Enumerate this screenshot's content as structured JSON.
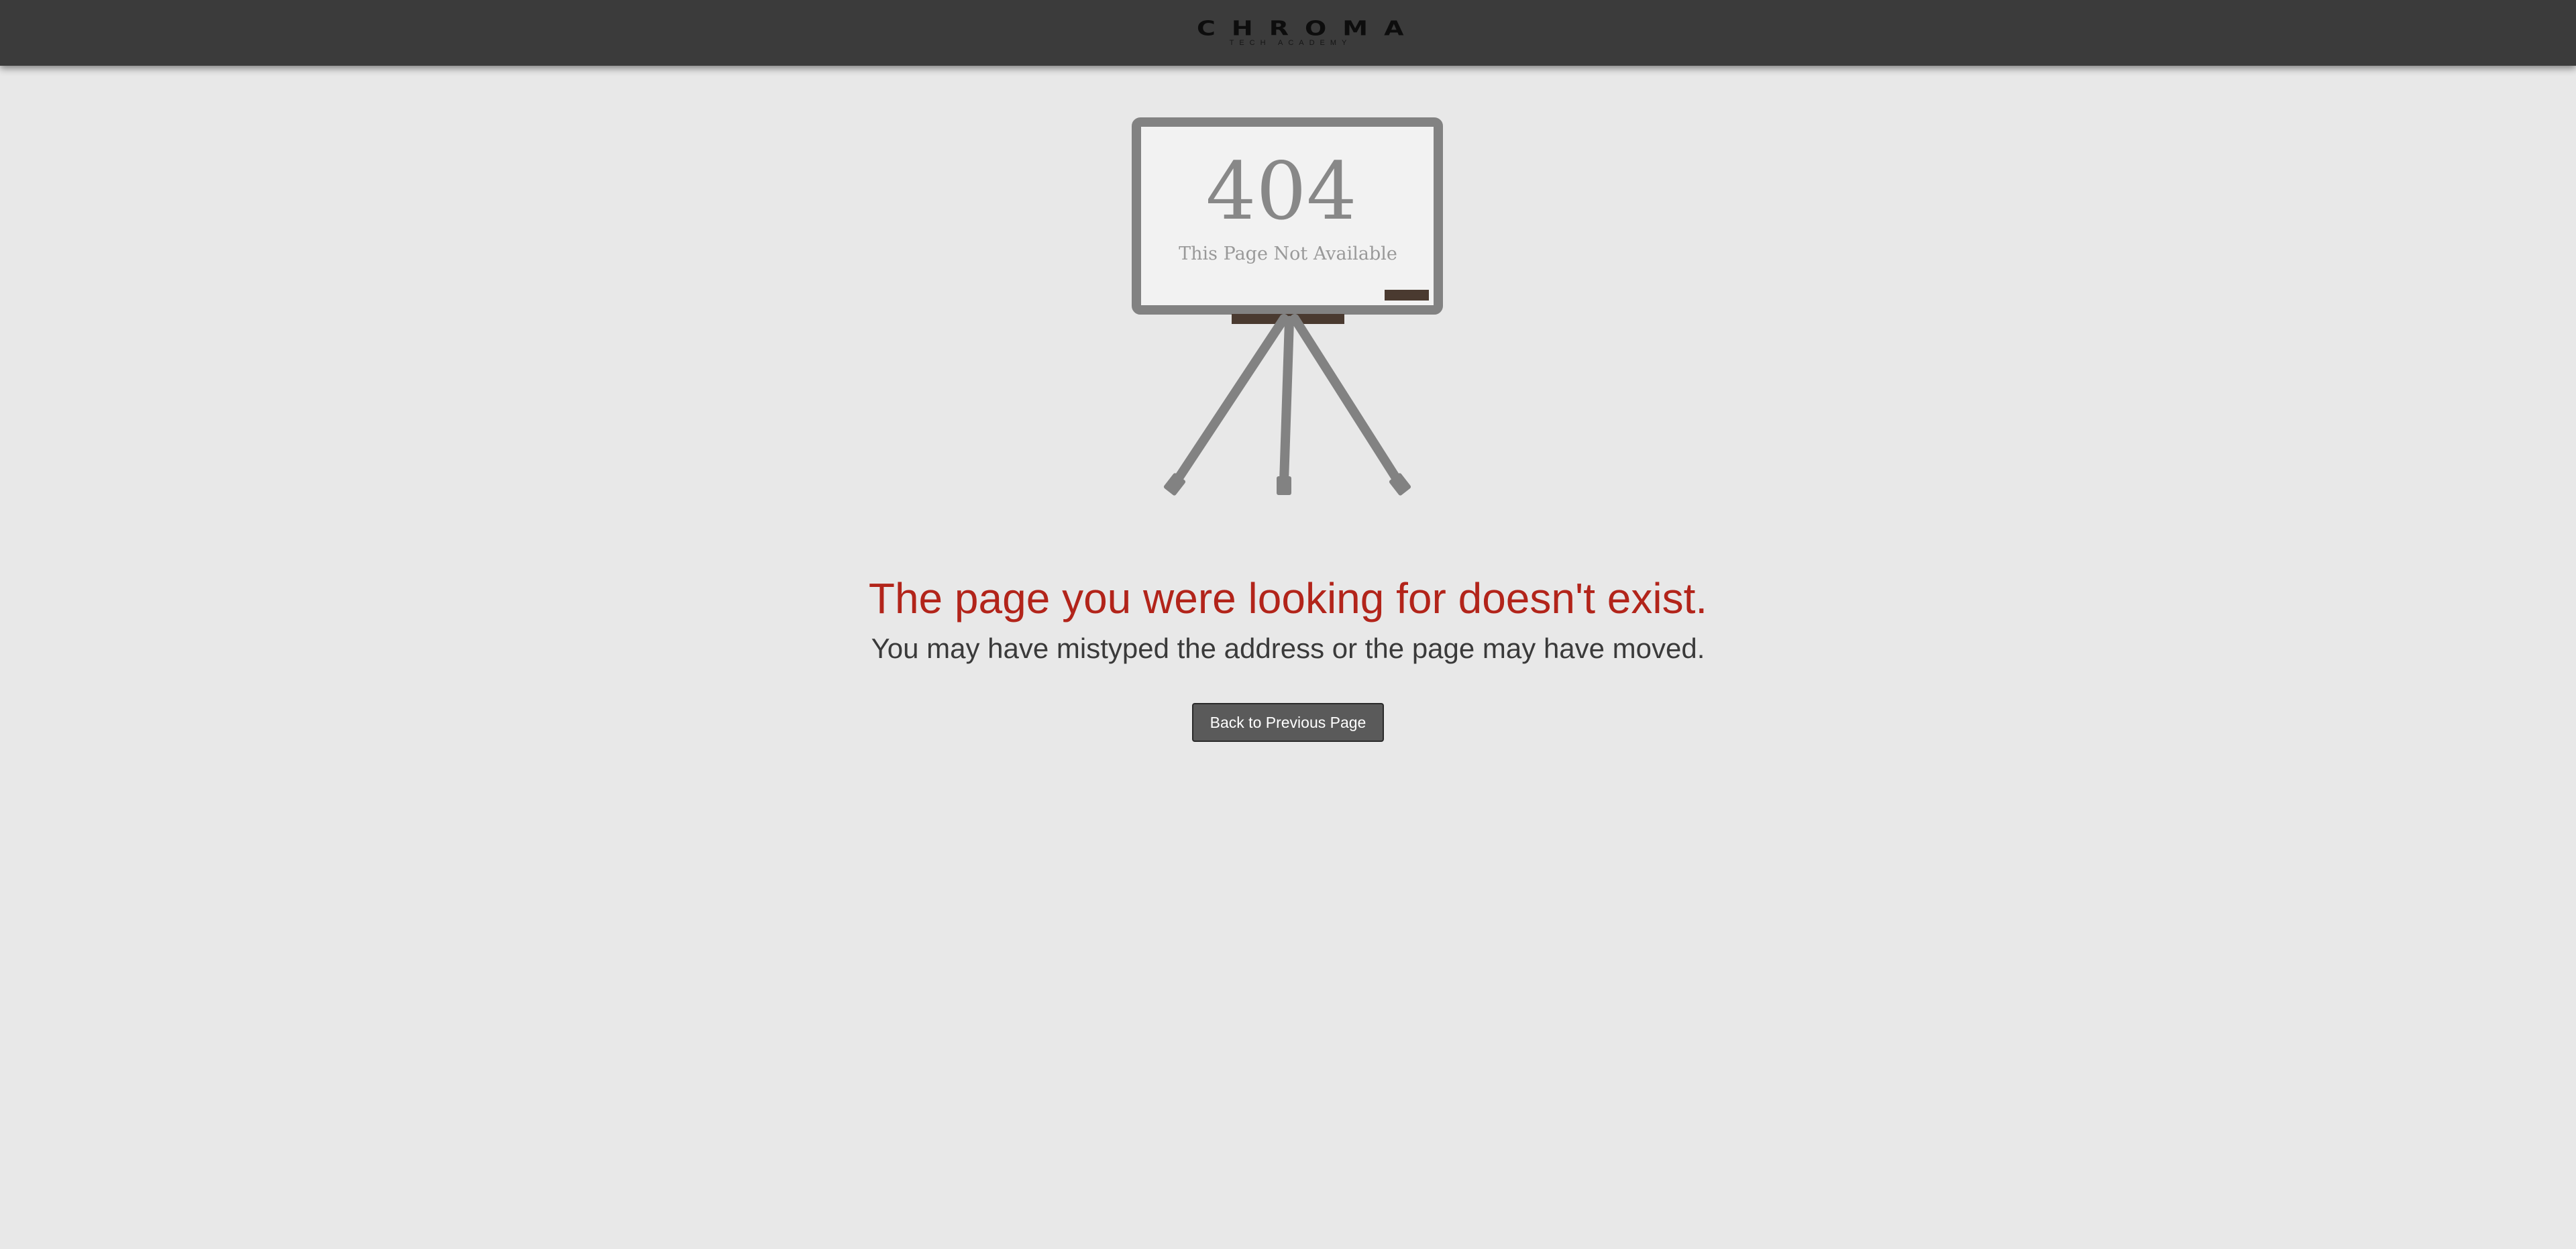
{
  "header": {
    "logo_main": "CHROMA",
    "logo_sub": "TECH ACADEMY"
  },
  "illustration": {
    "board_code": "404",
    "board_text": "This Page Not Available"
  },
  "message": {
    "headline": "The page you were looking for doesn't exist.",
    "subline": "You may have mistyped the address or the page may have moved."
  },
  "actions": {
    "back_label": "Back to Previous Page"
  },
  "colors": {
    "header_bg": "#3b3b3b",
    "page_bg": "#e8e8e8",
    "headline": "#b2241a",
    "button_bg": "#5a5a5a"
  }
}
